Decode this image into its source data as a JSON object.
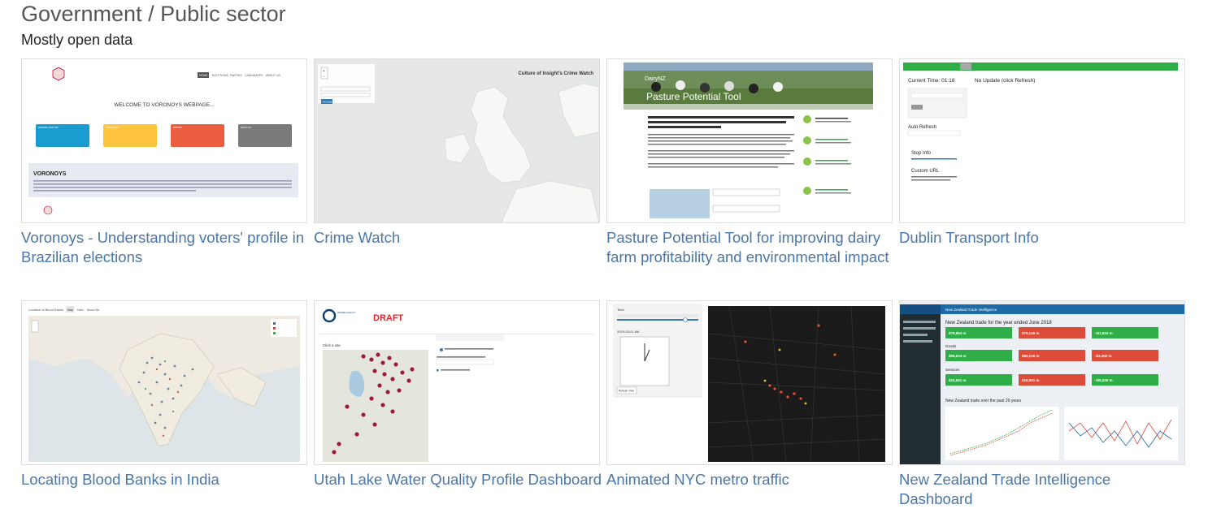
{
  "section": {
    "title": "Government / Public sector",
    "subtitle": "Mostly open data"
  },
  "cards": [
    {
      "caption": "Voronoys - Understanding voters' profile in Brazilian elections",
      "thumb": {
        "nav": [
          "HOME",
          "ELECTIONS",
          "PARTIES",
          "CANDIDATES",
          "ABOUT US"
        ],
        "welcome": "WELCOME TO VORONOYS WEBPAGE...",
        "tiles": [
          "GENERAL ANALYSIS",
          "CANDIDATES",
          "PARTIES",
          "ABOUT US"
        ],
        "heading": "VORONOYS"
      }
    },
    {
      "caption": "Crime Watch",
      "thumb": {
        "heading": "Culture of Insight's Crime Watch",
        "button": "Get Data"
      }
    },
    {
      "caption": "Pasture Potential Tool for improving dairy farm profitability and environmental impact",
      "thumb": {
        "banner": "Pasture Potential Tool",
        "brand": "DairyNZ"
      }
    },
    {
      "caption": "Dublin Transport Info",
      "thumb": {
        "time_label": "Current Time: 01:18",
        "update": "No Update (click Refresh)",
        "auto_refresh": "Auto Refresh",
        "stop_info": "Stop Info",
        "custom_url": "Custom URL"
      }
    },
    {
      "caption": "Locating Blood Banks in India",
      "thumb": {
        "title": "Location of Blood Banks",
        "tabs": [
          "Map",
          "Data",
          "About Me"
        ]
      }
    },
    {
      "caption": "Utah Lake Water Quality Profile Dashboard",
      "thumb": {
        "badge": "DRAFT",
        "click_hint": "Click a site",
        "org": "WATER QUALITY"
      }
    },
    {
      "caption": "Animated NYC metro traffic",
      "thumb": {
        "time_label": "Time",
        "date": "2019-03-01 AM",
        "button": "Refresh View"
      }
    },
    {
      "caption": "New Zealand Trade Intelligence Dashboard",
      "thumb": {
        "header": "New Zealand Trade Intelligence",
        "headline": "New Zealand trade for the year ended June 2018",
        "goods": "Goods",
        "services": "Services",
        "trend": "New Zealand trade over the past 20 years",
        "values_row1": [
          "$79,964 m",
          "$79,149 m",
          "+$1,815 m"
        ],
        "values_row2": [
          "$56,633 m",
          "$59,238 m",
          "-$3,356 m"
        ],
        "values_row3": [
          "$24,551 m",
          "$19,901 m",
          "+$5,200 m"
        ]
      }
    }
  ],
  "colors": {
    "link": "#4a76a8",
    "title": "#555555",
    "tile_blue": "#1b9cd0",
    "tile_yellow": "#ffc43d",
    "tile_red": "#ea5e3f",
    "tile_grey": "#7a7a7a",
    "nz_green": "#2fae47",
    "nz_red": "#dd4b39",
    "nz_header": "#1c6aa8",
    "draft_red": "#e0242a"
  }
}
